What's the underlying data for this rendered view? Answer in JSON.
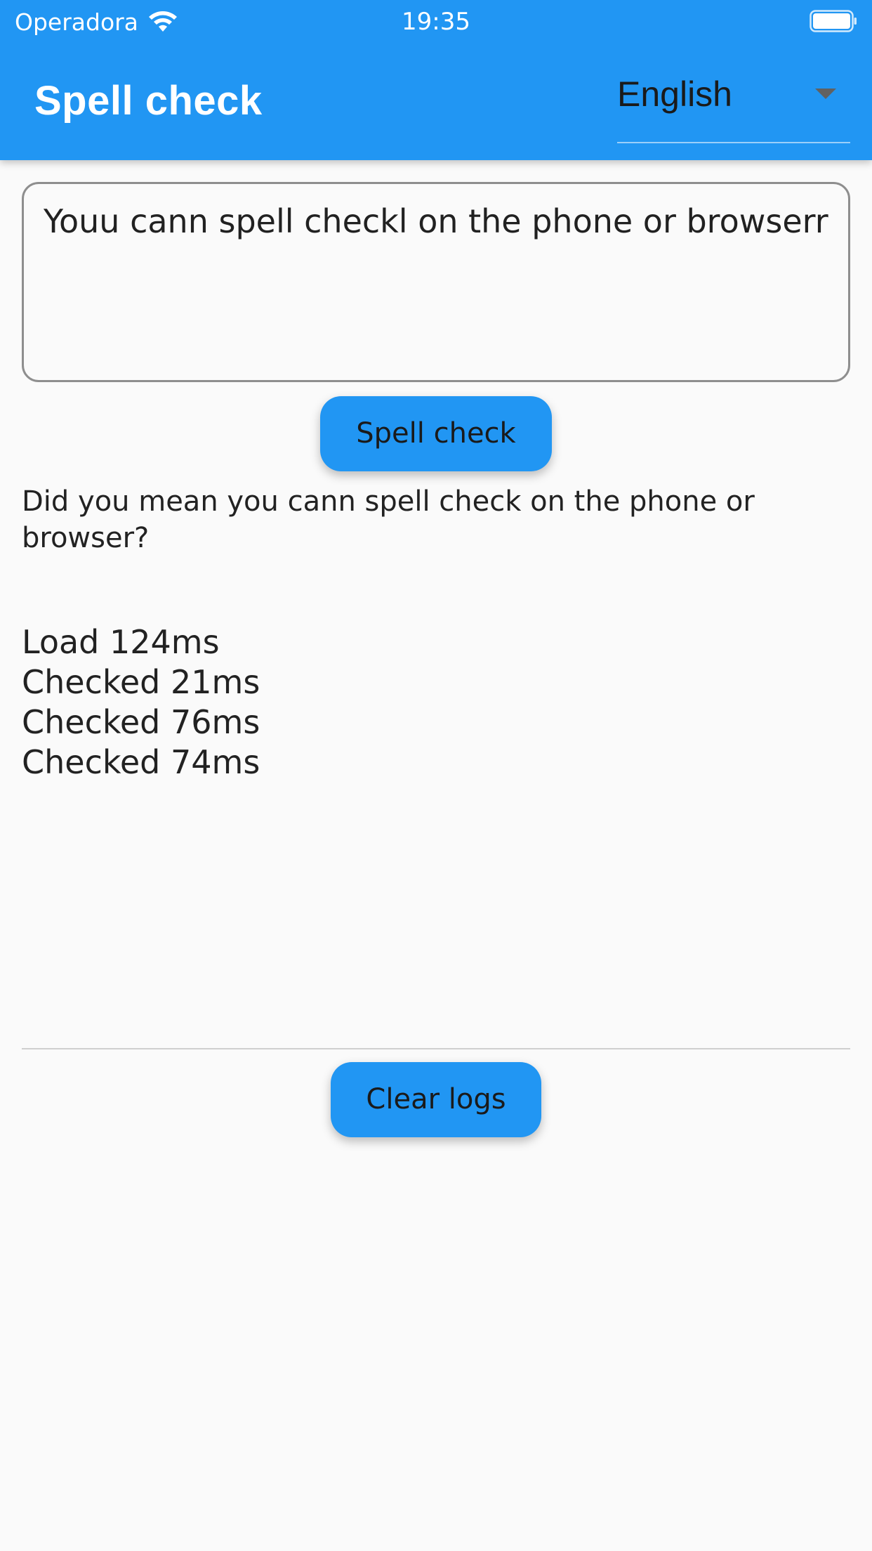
{
  "status_bar": {
    "carrier": "Operadora",
    "time": "19:35",
    "icons": [
      "wifi-icon",
      "battery-icon"
    ]
  },
  "app_bar": {
    "title": "Spell check",
    "language_dropdown": {
      "selected": "English",
      "icon": "dropdown-arrow-icon"
    },
    "color": "#2196f3"
  },
  "input": {
    "value": "Youu cann spell checkl on the phone or browserr"
  },
  "buttons": {
    "spell_check": "Spell check",
    "clear_logs": "Clear logs"
  },
  "result": {
    "suggestion": "Did you mean you cann spell check on the phone or browser?"
  },
  "logs": [
    "Load 124ms",
    "Checked 21ms",
    "Checked 76ms",
    "Checked 74ms"
  ]
}
